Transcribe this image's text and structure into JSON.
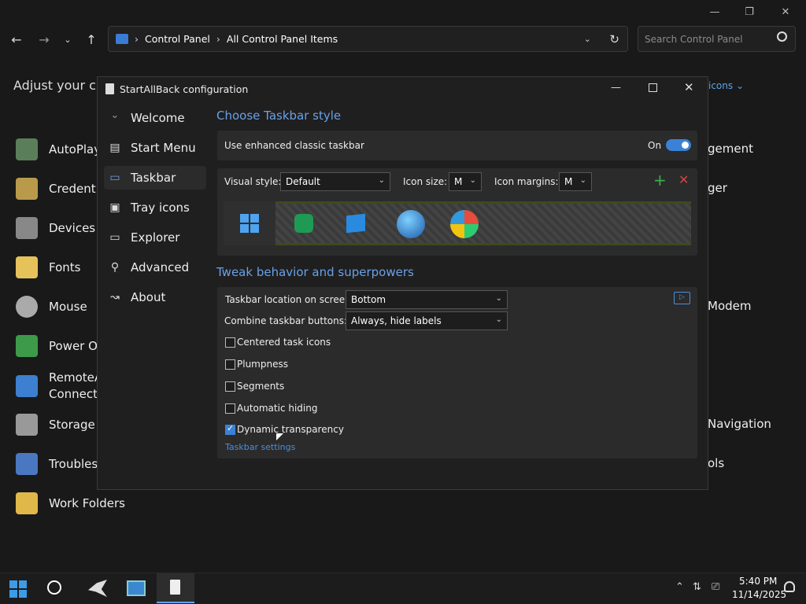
{
  "explorer": {
    "address_crumbs": [
      "Control Panel",
      "All Control Panel Items"
    ],
    "search_placeholder": "Search Control Panel",
    "heading_partial": "Adjust your cor",
    "view_by_partial": "icons ⌄",
    "items_left": [
      "AutoPlay",
      "Credenti",
      "Devices a",
      "Fonts",
      "Mouse",
      "Power Op",
      "RemoteA\nConnecti",
      "Storage S",
      "Troublesh",
      "Work Folders"
    ],
    "items_right": [
      "gement",
      "ger",
      "Modem",
      "Navigation",
      "ols"
    ]
  },
  "dialog": {
    "title": "StartAllBack configuration",
    "nav": [
      {
        "label": "Welcome",
        "icon": "smile-icon"
      },
      {
        "label": "Start Menu",
        "icon": "start-menu-icon"
      },
      {
        "label": "Taskbar",
        "icon": "taskbar-icon"
      },
      {
        "label": "Tray icons",
        "icon": "tray-icon"
      },
      {
        "label": "Explorer",
        "icon": "folder-icon"
      },
      {
        "label": "Advanced",
        "icon": "wrench-icon"
      },
      {
        "label": "About",
        "icon": "about-icon"
      }
    ],
    "section1": "Choose Taskbar style",
    "enhanced_label": "Use enhanced classic taskbar",
    "enhanced_state": "On",
    "visual_style_label": "Visual style:",
    "visual_style_value": "Default",
    "icon_size_label": "Icon size:",
    "icon_size_value": "M",
    "icon_margins_label": "Icon margins:",
    "icon_margins_value": "M",
    "section2": "Tweak behavior and superpowers",
    "location_label": "Taskbar location on screen:",
    "location_value": "Bottom",
    "combine_label": "Combine taskbar buttons:",
    "combine_value": "Always, hide labels",
    "checks": [
      {
        "label": "Centered task icons",
        "checked": false
      },
      {
        "label": "Plumpness",
        "checked": false
      },
      {
        "label": "Segments",
        "checked": false
      },
      {
        "label": "Automatic hiding",
        "checked": false
      },
      {
        "label": "Dynamic transparency",
        "checked": true
      }
    ],
    "settings_link": "Taskbar settings"
  },
  "taskbar": {
    "time": "5:40 PM",
    "date": "11/14/2025"
  },
  "colors": {
    "accent": "#3b82d6",
    "link": "#6aa0e8"
  }
}
